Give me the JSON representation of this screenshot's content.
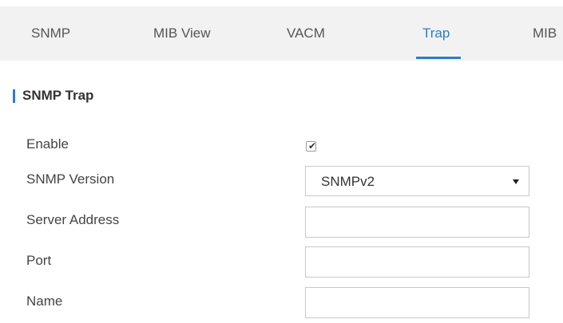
{
  "tabs": [
    {
      "label": "SNMP",
      "active": false
    },
    {
      "label": "MIB View",
      "active": false
    },
    {
      "label": "VACM",
      "active": false
    },
    {
      "label": "Trap",
      "active": true
    },
    {
      "label": "MIB",
      "active": false
    }
  ],
  "section": {
    "title": "SNMP Trap"
  },
  "form": {
    "enable": {
      "label": "Enable",
      "checked": true
    },
    "snmp_version": {
      "label": "SNMP Version",
      "value": "SNMPv2"
    },
    "server_address": {
      "label": "Server Address",
      "value": ""
    },
    "port": {
      "label": "Port",
      "value": ""
    },
    "name": {
      "label": "Name",
      "value": ""
    }
  },
  "colors": {
    "accent": "#2c7ec8",
    "tab_background": "#f2f2f2",
    "input_border": "#c8c8c8"
  }
}
